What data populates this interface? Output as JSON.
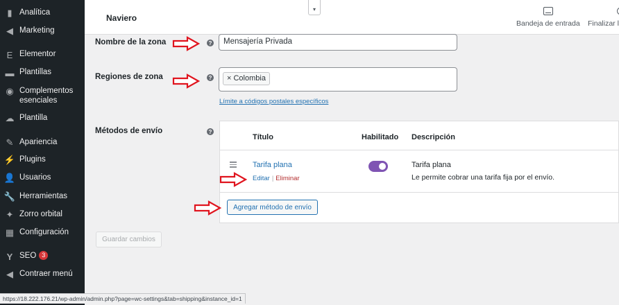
{
  "sidebar": {
    "items": [
      {
        "label": "Analítica",
        "icon": "analytics-icon",
        "glyph": "▮"
      },
      {
        "label": "Marketing",
        "icon": "megaphone-icon",
        "glyph": "◀"
      },
      {
        "label": "Elementor",
        "icon": "elementor-icon",
        "glyph": "E"
      },
      {
        "label": "Plantillas",
        "icon": "folder-icon",
        "glyph": "▬"
      },
      {
        "label": "Complementos esenciales",
        "icon": "ea-icon",
        "glyph": "◉"
      },
      {
        "label": "Plantilla",
        "icon": "cloud-icon",
        "glyph": "☁"
      },
      {
        "label": "Apariencia",
        "icon": "brush-icon",
        "glyph": "✎"
      },
      {
        "label": "Plugins",
        "icon": "plugin-icon",
        "glyph": "⚡"
      },
      {
        "label": "Usuarios",
        "icon": "users-icon",
        "glyph": "👤"
      },
      {
        "label": "Herramientas",
        "icon": "wrench-icon",
        "glyph": "🔧"
      },
      {
        "label": "Zorro orbital",
        "icon": "fox-icon",
        "glyph": "✦"
      },
      {
        "label": "Configuración",
        "icon": "settings-icon",
        "glyph": "▦"
      },
      {
        "label": "SEO",
        "icon": "yoast-icon",
        "glyph": "Y",
        "badge": "3"
      },
      {
        "label": "Contraer menú",
        "icon": "collapse-menu-icon",
        "glyph": "◀"
      }
    ]
  },
  "topbar": {
    "title": "Naviero",
    "collapse_glyph": "▾",
    "inbox_label": "Bandeja de entrada",
    "finish_label": "Finalizar la"
  },
  "form": {
    "zone_name_label": "Nombre de la zona",
    "zone_name_value": "Mensajería Privada",
    "regions_label": "Regiones de zona",
    "region_chip": "× Colombia",
    "limit_link": "Límite a códigos postales específicos",
    "methods_label": "Métodos de envío",
    "help_glyph": "?"
  },
  "methods_table": {
    "headers": [
      "Título",
      "Habilitado",
      "Descripción"
    ],
    "rows": [
      {
        "title": "Tarifa plana",
        "edit": "Editar",
        "delete": "Eliminar",
        "enabled": true,
        "desc_title": "Tarifa plana",
        "desc_text": "Le permite cobrar una tarifa fija por el envío."
      }
    ],
    "add_button": "Agregar método de envío"
  },
  "save_button": "Guardar cambios",
  "status_url": "https://18.222.176.21/wp-admin/admin.php?page=wc-settings&tab=shipping&instance_id=1",
  "colors": {
    "sidebar_bg": "#1d2327",
    "link": "#2271b1",
    "toggle_on": "#7f54b3",
    "arrow": "#e0141e",
    "delete": "#b32d2e"
  }
}
